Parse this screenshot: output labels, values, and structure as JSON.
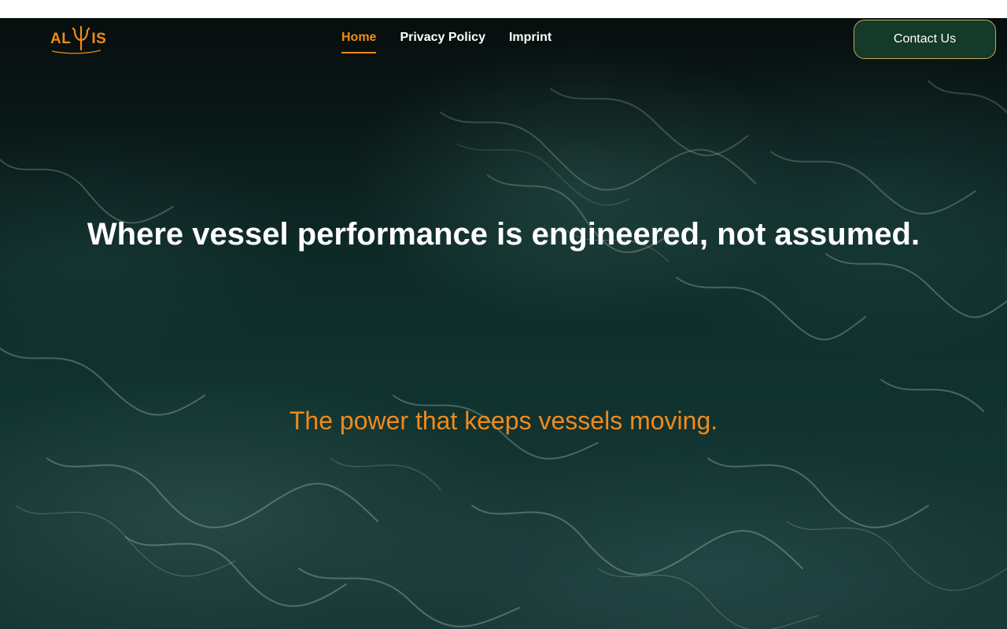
{
  "brand": {
    "logo_text_left": "AL",
    "logo_text_right": "IS",
    "accent_color": "#f08a1c",
    "logo_icon": "trident-icon"
  },
  "nav": {
    "items": [
      {
        "label": "Home",
        "active": true
      },
      {
        "label": "Privacy Policy",
        "active": false
      },
      {
        "label": "Imprint",
        "active": false
      }
    ]
  },
  "header": {
    "contact_label": "Contact Us",
    "contact_bg": "#143a29"
  },
  "hero": {
    "headline": "Where vessel performance is engineered, not assumed.",
    "tagline": "The power that keeps vessels moving.",
    "background": "ocean-waves-aerial"
  }
}
